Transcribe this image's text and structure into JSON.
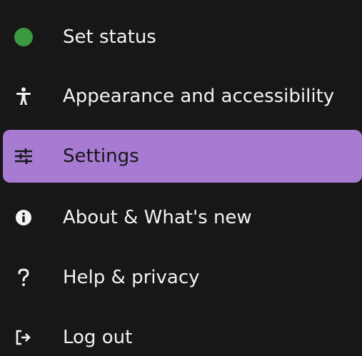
{
  "menu": {
    "items": [
      {
        "label": "Set status",
        "icon": "status-dot-icon",
        "color": "#3a9a3e",
        "active": false
      },
      {
        "label": "Appearance and accessibility",
        "icon": "accessibility-icon",
        "active": false
      },
      {
        "label": "Settings",
        "icon": "sliders-icon",
        "active": true
      },
      {
        "label": "About & What's new",
        "icon": "info-icon",
        "active": false
      },
      {
        "label": "Help & privacy",
        "icon": "question-icon",
        "active": false
      },
      {
        "label": "Log out",
        "icon": "logout-icon",
        "active": false
      }
    ]
  },
  "colors": {
    "background": "#171717",
    "active_background": "#a87bd3",
    "status_green": "#3a9a3e",
    "text": "#f3f3f3"
  }
}
